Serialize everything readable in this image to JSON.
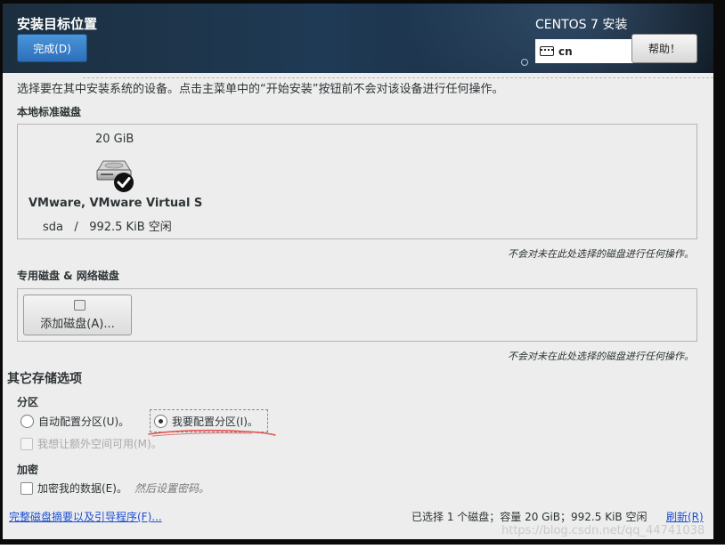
{
  "header": {
    "title": "安装目标位置",
    "done_label": "完成(D)",
    "product": "CENTOS 7 安装",
    "keyboard_layout": "cn",
    "help_label": "帮助！"
  },
  "instruction": "选择要在其中安装系统的设备。点击主菜单中的“开始安装”按钮前不会对该设备进行任何操作。",
  "local_disks": {
    "section_label": "本地标准磁盘",
    "disks": [
      {
        "size": "20 GiB",
        "name": "VMware, VMware Virtual S",
        "device": "sda",
        "separator": "/",
        "free": "992.5 KiB 空闲",
        "selected": true
      }
    ],
    "note": "不会对未在此处选择的磁盘进行任何操作。"
  },
  "special_disks": {
    "section_label": "专用磁盘 & 网络磁盘",
    "add_disk_label": "添加磁盘(A)...",
    "note": "不会对未在此处选择的磁盘进行任何操作。"
  },
  "other_options": {
    "title": "其它存储选项",
    "partitioning": {
      "label": "分区",
      "options": [
        {
          "label": "自动配置分区(U)。",
          "selected": false
        },
        {
          "label": "我要配置分区(I)。",
          "selected": true
        }
      ],
      "extra_space_label": "我想让额外空间可用(M)。"
    },
    "encryption": {
      "label": "加密",
      "checkbox_label": "加密我的数据(E)。",
      "hint": "然后设置密码。"
    }
  },
  "footer": {
    "summary_link": "完整磁盘摘要以及引导程序(F)...",
    "status": "已选择 1 个磁盘；容量 20 GiB；992.5 KiB 空闲",
    "refresh_label": "刷新(R)"
  },
  "watermark": "https://blog.csdn.net/qq_44741038",
  "colors": {
    "header_bg": "#1f3a55",
    "accent_button": "#3b82cc",
    "link": "#1c4fd1",
    "annotation_underline": "#e05050"
  }
}
